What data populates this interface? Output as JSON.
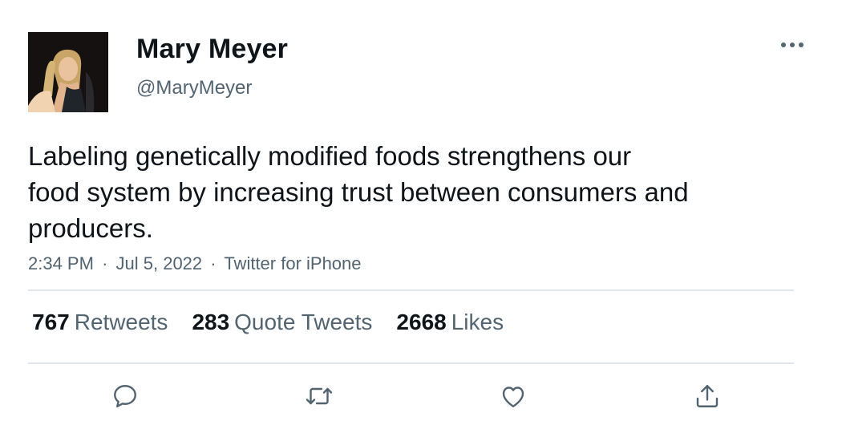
{
  "author": {
    "name": "Mary Meyer",
    "handle": "@MaryMeyer",
    "avatar_icon": "profile-photo"
  },
  "tweet": {
    "text_lines": [
      "Labeling genetically modified foods strengthens our",
      "food system by increasing trust between consumers and",
      "producers."
    ]
  },
  "meta": {
    "time": "2:34 PM",
    "separator": "·",
    "date": "Jul 5, 2022",
    "source": "Twitter for iPhone"
  },
  "stats": {
    "retweets": {
      "count": "767",
      "label": "Retweets"
    },
    "quote_tweets": {
      "count": "283",
      "label": "Quote Tweets"
    },
    "likes": {
      "count": "2668",
      "label": "Likes"
    }
  },
  "actions": {
    "reply_icon": "reply-icon",
    "retweet_icon": "retweet-icon",
    "like_icon": "heart-icon",
    "share_icon": "share-icon"
  },
  "colors": {
    "text_primary": "#0f1419",
    "text_secondary": "#536471",
    "divider": "#e1e6ea",
    "icon": "#536471"
  }
}
